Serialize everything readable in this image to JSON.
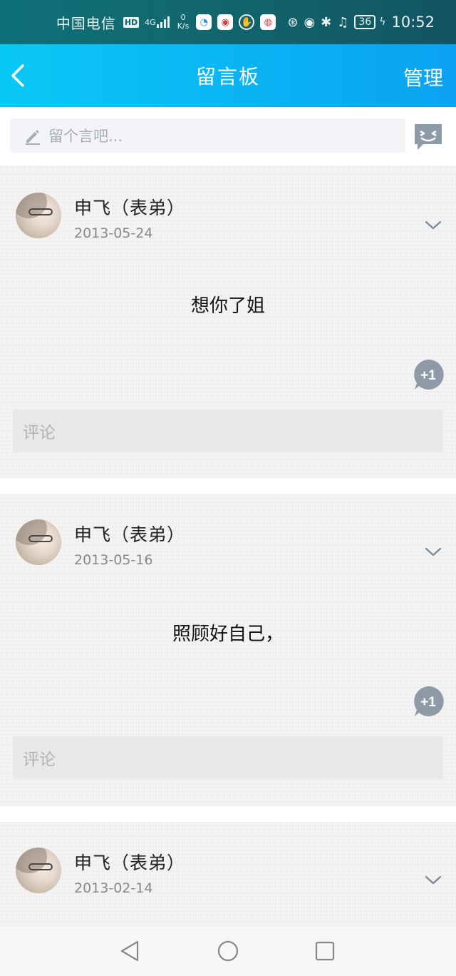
{
  "status_bar": {
    "carrier": "中国电信",
    "hd": "HD",
    "network": "4G",
    "speed_value": "0",
    "speed_unit": "K/s",
    "battery": "36",
    "time": "10:52"
  },
  "header": {
    "title": "留言板",
    "manage_label": "管理"
  },
  "compose": {
    "placeholder": "留个言吧..."
  },
  "messages": [
    {
      "author": "申飞（表弟）",
      "date": "2013-05-24",
      "content": "想你了姐",
      "plus_one": "+1",
      "comment_placeholder": "评论"
    },
    {
      "author": "申飞（表弟）",
      "date": "2013-05-16",
      "content": "照顾好自己，",
      "plus_one": "+1",
      "comment_placeholder": "评论"
    },
    {
      "author": "申飞（表弟）",
      "date": "2013-02-14"
    }
  ],
  "colors": {
    "header_gradient_start": "#0ac8f6",
    "header_gradient_end": "#0ba2f1",
    "status_bar": "#0f6470",
    "card_background": "#f2f2f2",
    "icon_gray": "#8e9aa8"
  }
}
